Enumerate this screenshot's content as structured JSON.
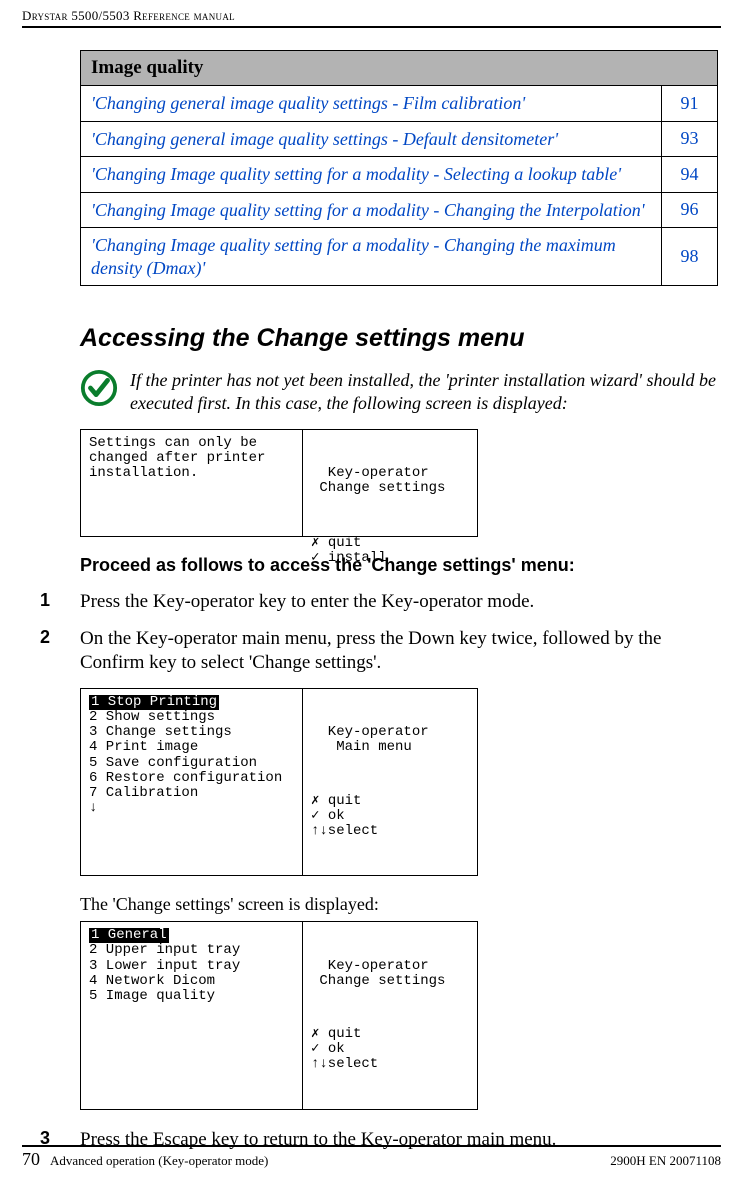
{
  "running_head": "Drystar 5500/5503 Reference manual",
  "table": {
    "header": "Image quality",
    "rows": [
      {
        "title": "'Changing general image quality settings - Film calibration'",
        "page": "91"
      },
      {
        "title": "'Changing general image quality settings - Default densitometer'",
        "page": "93"
      },
      {
        "title": "'Changing Image quality setting for a modality - Selecting a lookup table'",
        "page": "94"
      },
      {
        "title": "'Changing Image quality setting for a modality - Changing the Interpolation'",
        "page": "96"
      },
      {
        "title": "'Changing Image quality setting for a modality - Changing the maximum density (Dmax)'",
        "page": "98"
      }
    ]
  },
  "section_title": "Accessing the Change settings menu",
  "note_text": "If the printer has not yet been installed, the 'printer installation wizard' should be executed first. In this case, the following screen is displayed:",
  "lcd1": {
    "left": "Settings can only be\nchanged after printer\ninstallation.",
    "rightA": "  Key-operator\n Change settings",
    "rightB": "✗ quit\n✓ install"
  },
  "subhead": "Proceed as follows to access the 'Change settings' menu:",
  "steps": {
    "s1": "Press the Key-operator key to enter the Key-operator mode.",
    "s2": "On the Key-operator main menu, press the Down key twice, followed by the Confirm key to select 'Change settings'.",
    "s3": "Press the Escape key to return to the Key-operator main menu."
  },
  "lcd2": {
    "left_hl": "1 Stop Printing",
    "left": "2 Show settings\n3 Change settings\n4 Print image\n5 Save configuration\n6 Restore configuration\n7 Calibration\n↓",
    "rightA": "  Key-operator\n   Main menu",
    "rightB": "✗ quit\n✓ ok\n↑↓select"
  },
  "caption_after_lcd2": "The 'Change settings' screen is displayed:",
  "lcd3": {
    "left_hl": "1 General",
    "left": "2 Upper input tray\n3 Lower input tray\n4 Network Dicom\n5 Image quality",
    "rightA": "  Key-operator\n Change settings",
    "rightB": "✗ quit\n✓ ok\n↑↓select"
  },
  "footer": {
    "page_no": "70",
    "left": "Advanced operation (Key-operator mode)",
    "right": "2900H EN 20071108"
  }
}
